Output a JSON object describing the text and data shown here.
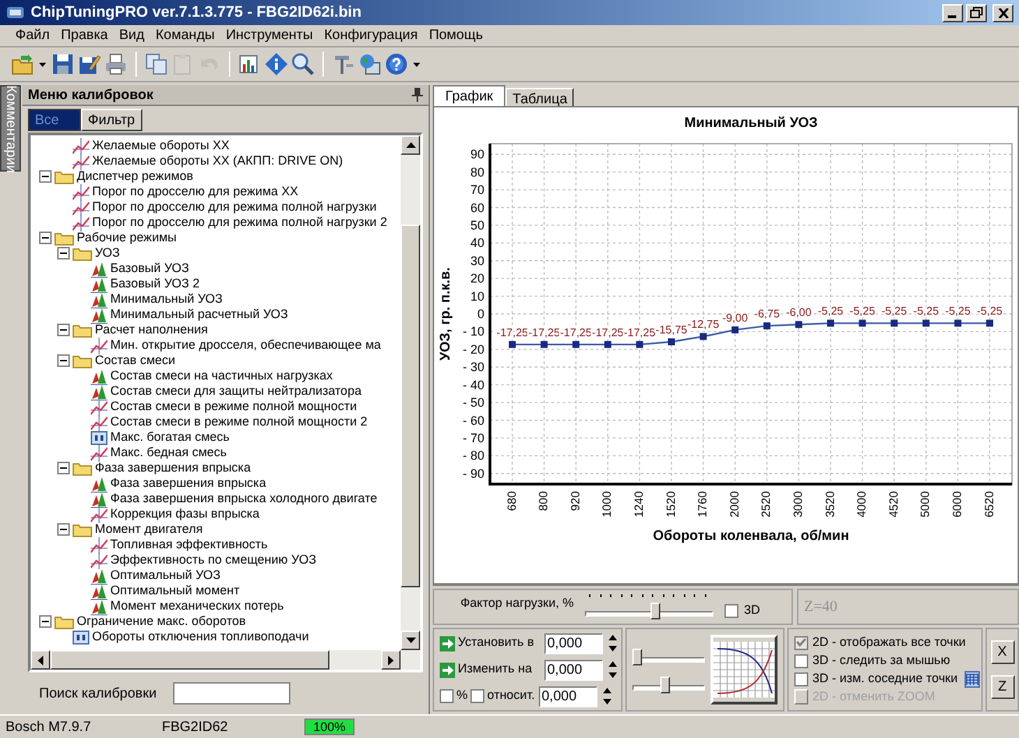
{
  "window": {
    "title": "ChipTuningPRO ver.7.1.3.775 - FBG2ID62i.bin"
  },
  "menu": [
    "Файл",
    "Правка",
    "Вид",
    "Команды",
    "Инструменты",
    "Конфигурация",
    "Помощь"
  ],
  "toolbar": [
    [
      {
        "kind": "open",
        "disabled": false
      },
      {
        "kind": "dropdown",
        "disabled": false
      },
      {
        "kind": "save",
        "disabled": false
      },
      {
        "kind": "save_as",
        "disabled": false
      },
      {
        "kind": "print",
        "disabled": false
      }
    ],
    [
      {
        "kind": "copy",
        "disabled": false
      },
      {
        "kind": "paste",
        "disabled": true
      },
      {
        "kind": "undo",
        "disabled": true
      }
    ],
    [
      {
        "kind": "chart",
        "disabled": false
      },
      {
        "kind": "info",
        "disabled": false
      },
      {
        "kind": "zoom",
        "disabled": false
      }
    ],
    [
      {
        "kind": "tools",
        "disabled": false
      },
      {
        "kind": "web",
        "disabled": false
      },
      {
        "kind": "help",
        "disabled": false
      },
      {
        "kind": "dropdown",
        "disabled": false
      }
    ]
  ],
  "side_tab": {
    "label": "Комментарии"
  },
  "calibration_panel": {
    "title": "Меню калибровок",
    "tabs": [
      {
        "label": "Все",
        "selected": true
      },
      {
        "label": "Фильтр",
        "selected": false
      }
    ],
    "tree": [
      {
        "children": [
          {
            "label": "Желаемые обороты ХХ",
            "kind": "curve"
          },
          {
            "label": "Желаемые обороты ХХ (АКПП: DRIVE ON)",
            "kind": "curve"
          }
        ]
      },
      {
        "label": "Диспетчер режимов",
        "kind": "folder",
        "expanded": true,
        "children": [
          {
            "label": "Порог по дросселю для режима ХХ",
            "kind": "curve"
          },
          {
            "label": "Порог по дросселю для режима полной нагрузки",
            "kind": "curve"
          },
          {
            "label": "Порог по дросселю для режима полной нагрузки 2",
            "kind": "curve"
          }
        ]
      },
      {
        "label": "Рабочие режимы",
        "kind": "folder",
        "expanded": true,
        "children": [
          {
            "label": "УОЗ",
            "kind": "folder",
            "expanded": true,
            "children": [
              {
                "label": "Базовый УОЗ",
                "kind": "map"
              },
              {
                "label": "Базовый УОЗ 2",
                "kind": "map"
              },
              {
                "label": "Минимальный УОЗ",
                "kind": "map"
              },
              {
                "label": "Минимальный расчетный УОЗ",
                "kind": "map"
              }
            ]
          },
          {
            "label": "Расчет наполнения",
            "kind": "folder",
            "expanded": true,
            "children": [
              {
                "label": "Мин. открытие дросселя, обеспечивающее ма",
                "kind": "curve"
              }
            ]
          },
          {
            "label": "Состав смеси",
            "kind": "folder",
            "expanded": true,
            "children": [
              {
                "label": "Состав смеси на частичных нагрузках",
                "kind": "map"
              },
              {
                "label": "Состав смеси для защиты нейтрализатора",
                "kind": "map"
              },
              {
                "label": "Состав смеси в режиме полной мощности",
                "kind": "curve"
              },
              {
                "label": "Состав смеси в режиме полной мощности 2",
                "kind": "curve"
              },
              {
                "label": "Макс. богатая смесь",
                "kind": "value"
              },
              {
                "label": "Макс. бедная смесь",
                "kind": "curve"
              }
            ]
          },
          {
            "label": "Фаза завершения впрыска",
            "kind": "folder",
            "expanded": true,
            "children": [
              {
                "label": "Фаза завершения впрыска",
                "kind": "map"
              },
              {
                "label": "Фаза завершения впрыска холодного двигате",
                "kind": "map"
              },
              {
                "label": "Коррекция фазы впрыска",
                "kind": "curve"
              }
            ]
          },
          {
            "label": "Момент двигателя",
            "kind": "folder",
            "expanded": true,
            "children": [
              {
                "label": "Топливная эффективность",
                "kind": "curve"
              },
              {
                "label": "Эффективность по смещению УОЗ",
                "kind": "curve"
              },
              {
                "label": "Оптимальный УОЗ",
                "kind": "map"
              },
              {
                "label": "Оптимальный момент",
                "kind": "map"
              },
              {
                "label": "Момент механических потерь",
                "kind": "map"
              }
            ]
          }
        ]
      },
      {
        "label": "Ограничение макс. оборотов",
        "kind": "folder",
        "expanded": true,
        "children": [
          {
            "label": "Обороты отключения топливоподачи",
            "kind": "value"
          }
        ]
      }
    ],
    "search": {
      "label": "Поиск калибровки"
    }
  },
  "view_tabs": [
    {
      "label": "График",
      "selected": true
    },
    {
      "label": "Таблица",
      "selected": false
    }
  ],
  "chart": {
    "chart_data": {
      "type": "line",
      "title": "Минимальный УОЗ",
      "xlabel": "Обороты коленвала, об/мин",
      "ylabel": "УОЗ, гр. п.к.в.",
      "categories": [
        "680",
        "800",
        "920",
        "1000",
        "1240",
        "1520",
        "1760",
        "2000",
        "2520",
        "3000",
        "3520",
        "4000",
        "4520",
        "5000",
        "6000",
        "6520"
      ],
      "values": [
        -17.25,
        -17.25,
        -17.25,
        -17.25,
        -17.25,
        -15.75,
        -12.75,
        -9.0,
        -6.75,
        -6.0,
        -5.25,
        -5.25,
        -5.25,
        -5.25,
        -5.25,
        -5.25
      ],
      "ylim": [
        -96,
        96
      ],
      "yticks": [
        90,
        80,
        70,
        60,
        50,
        40,
        30,
        20,
        10,
        0,
        {
          "value": -10,
          "label": "- 10"
        },
        {
          "value": -20,
          "label": "- 20"
        },
        {
          "value": -30,
          "label": "- 30"
        },
        {
          "value": -40,
          "label": "- 40"
        },
        {
          "value": -50,
          "label": "- 50"
        },
        {
          "value": -60,
          "label": "- 60"
        },
        {
          "value": -70,
          "label": "- 70"
        },
        {
          "value": -80,
          "label": "- 80"
        },
        {
          "value": -90,
          "label": "- 90"
        }
      ],
      "data_labels": true,
      "value_labels": [
        "-17,25",
        "-17,25",
        "-17,25",
        "-17,25",
        "-17,25",
        "-15,75",
        "-12,75",
        "-9,00",
        "-6,75",
        "-6,00",
        "-5,25",
        "-5,25",
        "-5,25",
        "-5,25",
        "-5,25",
        "-5,25"
      ],
      "grid": true,
      "marker": "square"
    }
  },
  "load_factor": {
    "label": "Фактор нагрузки, %",
    "level": 0.55,
    "checkbox": {
      "label": "3D",
      "checked": false
    },
    "z_value": "Z=40"
  },
  "edit_rows": [
    {
      "kind": "action",
      "label": "Установить в",
      "value": "0,000"
    },
    {
      "kind": "action",
      "label": "Изменить на",
      "value": "0,000"
    },
    {
      "kind": "options",
      "options": [
        {
          "label": "%",
          "checked": false
        },
        {
          "label": "относит.",
          "checked": false
        }
      ],
      "value": "0,000"
    }
  ],
  "sliders": [
    {
      "level": 0
    },
    {
      "level": 0.45
    }
  ],
  "view_options": [
    {
      "kind": "checkbox",
      "label": "2D - отображать все точки",
      "checked": true,
      "disabled": true
    },
    {
      "kind": "checkbox",
      "label": "3D - следить за мышью",
      "checked": false,
      "disabled": false
    },
    {
      "kind": "checkbox",
      "label": "3D - изм. соседние точки",
      "checked": false,
      "disabled": false
    },
    {
      "kind": "button",
      "label": "2D - отменить ZOOM",
      "disabled": true
    }
  ],
  "axis_buttons": [
    "X",
    "Z"
  ],
  "status_bar": {
    "device": "Bosch M7.9.7",
    "file": "FBG2ID62",
    "progress": {
      "level": 1,
      "label": "100%"
    }
  }
}
